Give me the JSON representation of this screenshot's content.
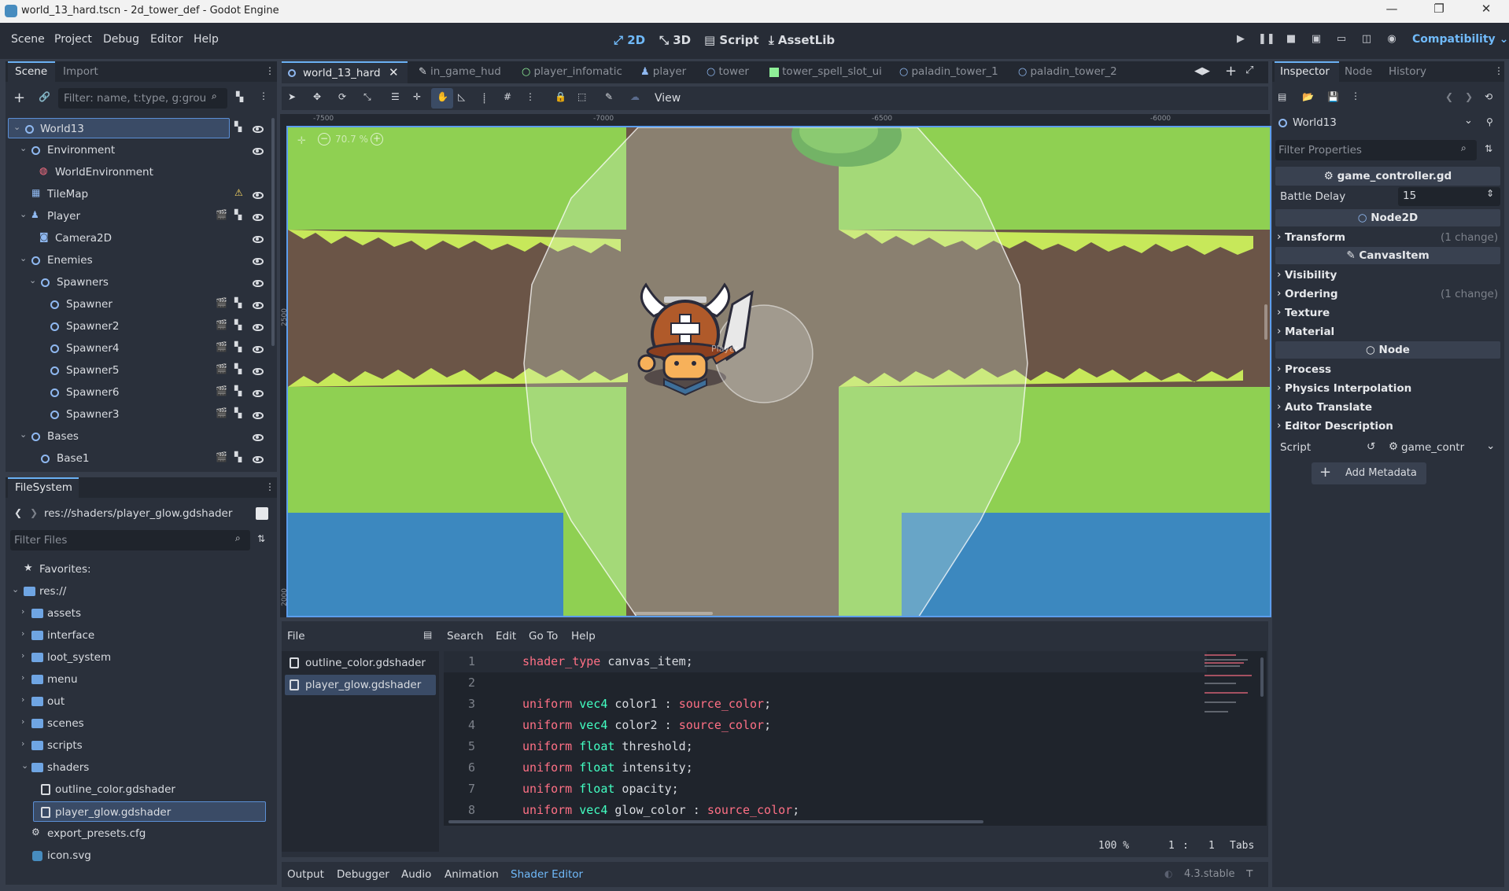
{
  "window": {
    "title": "world_13_hard.tscn - 2d_tower_def - Godot Engine",
    "minimize": "—",
    "maximize": "❐",
    "close": "✕"
  },
  "menu": {
    "items": [
      "Scene",
      "Project",
      "Debug",
      "Editor",
      "Help"
    ],
    "modes": [
      "2D",
      "3D",
      "Script",
      "AssetLib"
    ],
    "renderer": "Compatibility"
  },
  "scene_dock": {
    "tabs": [
      "Scene",
      "Import"
    ],
    "filter_placeholder": "Filter: name, t:type, g:grou",
    "tree": [
      {
        "label": "World13",
        "depth": 0,
        "selected": true
      },
      {
        "label": "Environment",
        "depth": 1
      },
      {
        "label": "WorldEnvironment",
        "depth": 2
      },
      {
        "label": "TileMap",
        "depth": 1
      },
      {
        "label": "Player",
        "depth": 1
      },
      {
        "label": "Camera2D",
        "depth": 2
      },
      {
        "label": "Enemies",
        "depth": 1
      },
      {
        "label": "Spawners",
        "depth": 2
      },
      {
        "label": "Spawner",
        "depth": 3
      },
      {
        "label": "Spawner2",
        "depth": 3
      },
      {
        "label": "Spawner4",
        "depth": 3
      },
      {
        "label": "Spawner5",
        "depth": 3
      },
      {
        "label": "Spawner6",
        "depth": 3
      },
      {
        "label": "Spawner3",
        "depth": 3
      },
      {
        "label": "Bases",
        "depth": 1
      },
      {
        "label": "Base1",
        "depth": 2
      }
    ]
  },
  "filesystem": {
    "title": "FileSystem",
    "path": "res://shaders/player_glow.gdshader",
    "filter_placeholder": "Filter Files",
    "favorites": "Favorites:",
    "root": "res://",
    "folders": [
      "assets",
      "interface",
      "loot_system",
      "menu",
      "out",
      "scenes",
      "scripts",
      "shaders"
    ],
    "shader_files": [
      "outline_color.gdshader",
      "player_glow.gdshader"
    ],
    "root_files": [
      "export_presets.cfg",
      "icon.svg"
    ]
  },
  "editor_tabs": [
    "world_13_hard",
    "in_game_hud",
    "player_infomatic",
    "player",
    "tower",
    "tower_spell_slot_ui",
    "paladin_tower_1",
    "paladin_tower_2"
  ],
  "toolbar": {
    "view": "View",
    "zoom": "70.7 %"
  },
  "ruler": {
    "x_labels": [
      "-7500",
      "-7000",
      "-6500",
      "-6000"
    ],
    "y_labels": [
      "2500",
      "2000"
    ]
  },
  "viewport": {
    "player_label": "Player"
  },
  "shader_editor": {
    "menus": [
      "File",
      "Search",
      "Edit",
      "Go To",
      "Help"
    ],
    "files": [
      "outline_color.gdshader",
      "player_glow.gdshader"
    ],
    "lines": [
      {
        "n": "1",
        "kw": "shader_type",
        "ty": "",
        "rest": " canvas_item;"
      },
      {
        "n": "2",
        "kw": "",
        "ty": "",
        "rest": ""
      },
      {
        "n": "3",
        "kw": "uniform",
        "ty": " vec4",
        "rest": " color1 : ",
        "tail": "source_color",
        "end": ";"
      },
      {
        "n": "4",
        "kw": "uniform",
        "ty": " vec4",
        "rest": " color2 : ",
        "tail": "source_color",
        "end": ";"
      },
      {
        "n": "5",
        "kw": "uniform",
        "ty": " float",
        "rest": " threshold;"
      },
      {
        "n": "6",
        "kw": "uniform",
        "ty": " float",
        "rest": " intensity;"
      },
      {
        "n": "7",
        "kw": "uniform",
        "ty": " float",
        "rest": " opacity;"
      },
      {
        "n": "8",
        "kw": "uniform",
        "ty": " vec4",
        "rest": " glow_color : ",
        "tail": "source_color",
        "end": ";"
      }
    ],
    "status_zoom": "100 %",
    "status_line": "1",
    "status_col": "1",
    "status_indent": "Tabs"
  },
  "bottom_tabs": [
    "Output",
    "Debugger",
    "Audio",
    "Animation",
    "Shader Editor"
  ],
  "version": "4.3.stable",
  "inspector": {
    "tabs": [
      "Inspector",
      "Node",
      "History"
    ],
    "object": "World13",
    "filter_placeholder": "Filter Properties",
    "script_header": "game_controller.gd",
    "battle_delay_label": "Battle Delay",
    "battle_delay_value": "15",
    "node2d": "Node2D",
    "transform": "Transform",
    "transform_change": "(1 change)",
    "canvasitem": "CanvasItem",
    "visibility": "Visibility",
    "ordering": "Ordering",
    "ordering_change": "(1 change)",
    "texture": "Texture",
    "material": "Material",
    "node": "Node",
    "process": "Process",
    "physics_interp": "Physics Interpolation",
    "auto_translate": "Auto Translate",
    "editor_desc": "Editor Description",
    "script_label": "Script",
    "script_value": "game_contr",
    "add_metadata": "Add Metadata"
  }
}
